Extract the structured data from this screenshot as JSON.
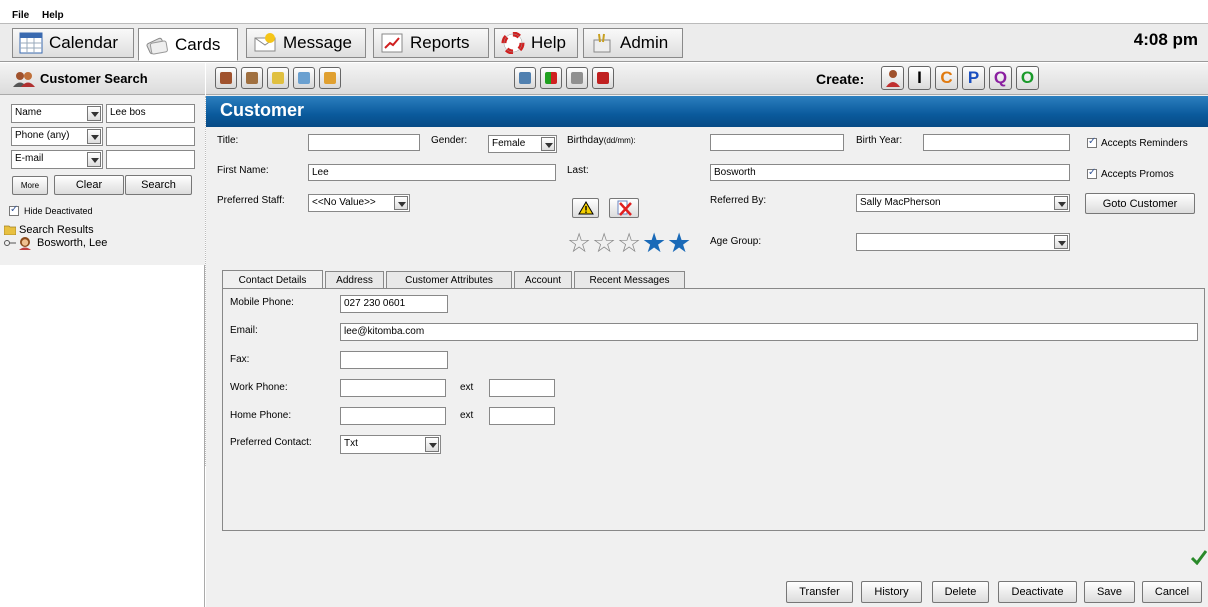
{
  "menu": {
    "file": "File",
    "help": "Help"
  },
  "top_tabs": [
    {
      "label": "Calendar"
    },
    {
      "label": "Cards"
    },
    {
      "label": "Message"
    },
    {
      "label": "Reports"
    },
    {
      "label": "Help"
    },
    {
      "label": "Admin"
    }
  ],
  "clock": "4:08 pm",
  "search": {
    "title": "Customer Search",
    "field1_type": "Name",
    "field1_value": "Lee bos",
    "field2_type": "Phone (any)",
    "field2_value": "",
    "field3_type": "E-mail",
    "field3_value": "",
    "more_label": "More",
    "clear_label": "Clear",
    "search_label": "Search",
    "hide_deactivated": "Hide Deactivated",
    "results_label": "Search Results",
    "result_item": "Bosworth, Lee"
  },
  "create": {
    "label": "Create:",
    "letters": [
      "I",
      "C",
      "P",
      "Q",
      "O"
    ]
  },
  "customer": {
    "banner": "Customer",
    "title_label": "Title:",
    "title_value": "",
    "gender_label": "Gender:",
    "gender_value": "Female",
    "birthday_label": "Birthday",
    "birthday_hint": "(dd/mm):",
    "birthday_value": "",
    "birth_year_label": "Birth Year:",
    "birth_year_value": "",
    "accepts_reminders": "Accepts Reminders",
    "first_name_label": "First Name:",
    "first_name_value": "Lee",
    "last_label": "Last:",
    "last_value": "Bosworth",
    "accepts_promos": "Accepts Promos",
    "preferred_staff_label": "Preferred Staff:",
    "preferred_staff_value": "<<No Value>>",
    "referred_by_label": "Referred By:",
    "referred_by_value": "Sally MacPherson",
    "goto_customer": "Goto Customer",
    "age_group_label": "Age Group:",
    "age_group_value": "",
    "rating": 2
  },
  "sub_tabs": [
    {
      "label": "Contact Details"
    },
    {
      "label": "Address"
    },
    {
      "label": "Customer Attributes"
    },
    {
      "label": "Account"
    },
    {
      "label": "Recent Messages"
    }
  ],
  "contact": {
    "mobile_label": "Mobile Phone:",
    "mobile_value": "027 230 0601",
    "email_label": "Email:",
    "email_value": "lee@kitomba.com",
    "fax_label": "Fax:",
    "fax_value": "",
    "work_label": "Work Phone:",
    "work_value": "",
    "ext_label": "ext",
    "work_ext": "",
    "home_label": "Home Phone:",
    "home_value": "",
    "home_ext": "",
    "preferred_label": "Preferred Contact:",
    "preferred_value": "Txt"
  },
  "actions": {
    "transfer": "Transfer",
    "history": "History",
    "delete": "Delete",
    "deactivate": "Deactivate",
    "save": "Save",
    "cancel": "Cancel"
  },
  "colors": {
    "banner": "#0a5a9c",
    "create_i": "#000000",
    "create_c": "#e07a10",
    "create_p": "#1a4fc0",
    "create_q": "#8a1fa0",
    "create_o": "#1a9a2a",
    "check": "#2a8a2a"
  }
}
